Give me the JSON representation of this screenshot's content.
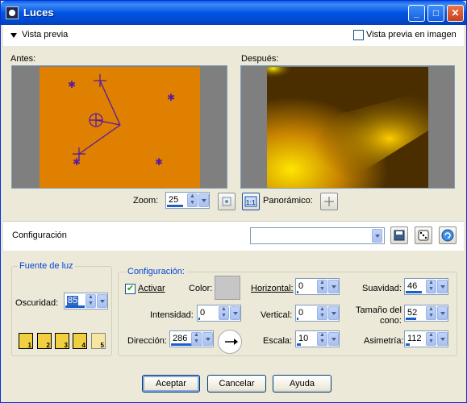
{
  "window": {
    "title": "Luces"
  },
  "preview": {
    "toggle_label": "Vista previa",
    "image_preview_label": "Vista previa en imagen",
    "image_preview_checked": false,
    "before_label": "Antes:",
    "after_label": "Después:",
    "zoom_label": "Zoom:",
    "zoom_value": "25",
    "panoramic_label": "Panorámico:"
  },
  "config_bar": {
    "label": "Configuración",
    "preset_value": ""
  },
  "light_source": {
    "title": "Fuente de luz",
    "darkness_label": "Oscuridad:",
    "darkness_value": "85",
    "light_buttons": [
      "1",
      "2",
      "3",
      "4",
      "5"
    ]
  },
  "settings": {
    "title": "Configuración:",
    "activate_label": "Activar",
    "activate_checked": true,
    "color_label": "Color:",
    "color_value": "#c6c6c6",
    "intensity_label": "Intensidad:",
    "intensity_value": "0",
    "direction_label": "Dirección:",
    "direction_value": "286",
    "horizontal_label": "Horizontal:",
    "horizontal_value": "0",
    "vertical_label": "Vertical:",
    "vertical_value": "0",
    "scale_label": "Escala:",
    "scale_value": "10",
    "softness_label": "Suavidad:",
    "softness_value": "46",
    "cone_label_1": "Tamaño del",
    "cone_label_2": "cono:",
    "cone_value": "52",
    "asymmetry_label": "Asimetría:",
    "asymmetry_value": "112"
  },
  "buttons": {
    "accept": "Aceptar",
    "cancel": "Cancelar",
    "help": "Ayuda"
  },
  "colors": {
    "orange": "#e08000",
    "light": "#ffd700",
    "marker": "#5a1aa0"
  }
}
